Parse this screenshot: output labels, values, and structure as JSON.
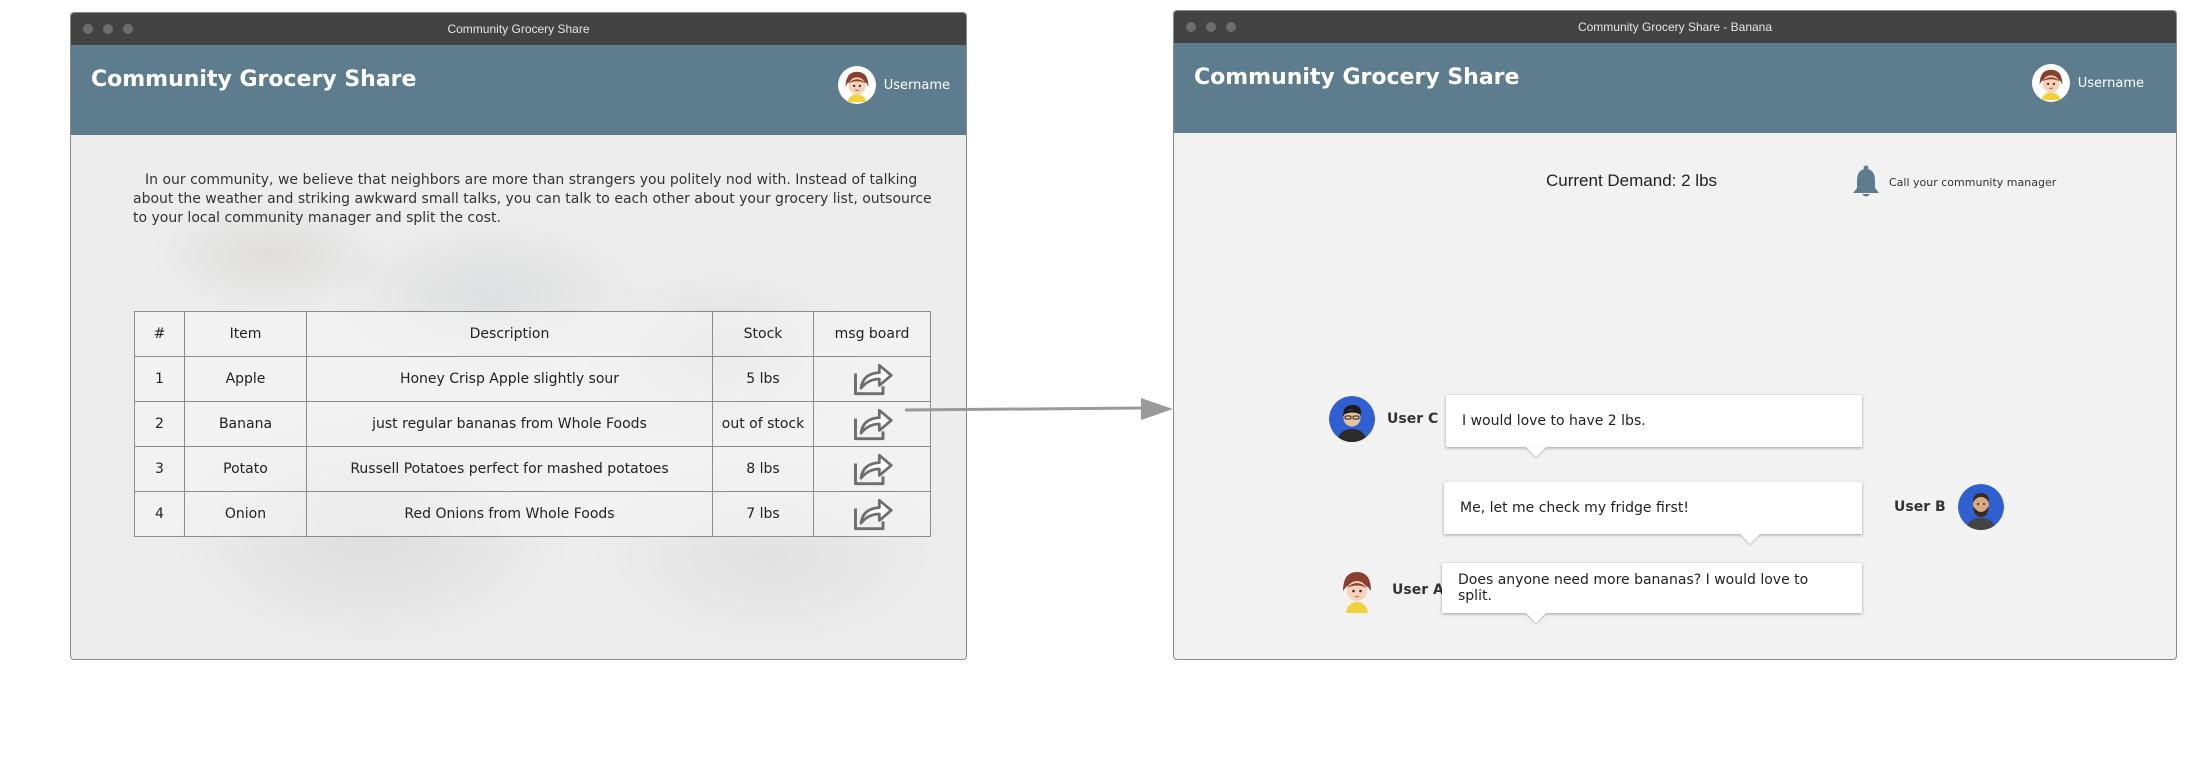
{
  "left_window": {
    "titlebar": "Community Grocery Share",
    "app_title": "Community Grocery Share",
    "username": "Username",
    "intro": "In our community, we believe that neighbors are more than strangers you politely nod with. Instead of talking about the weather and striking awkward small talks, you can talk to each other about your grocery list,  outsource to your local community manager and split the cost.",
    "table": {
      "headers": [
        "#",
        "Item",
        "Description",
        "Stock",
        "msg board"
      ],
      "rows": [
        {
          "num": "1",
          "item": "Apple",
          "description": "Honey Crisp Apple slightly sour",
          "stock": "5 lbs",
          "icon": "share-icon"
        },
        {
          "num": "2",
          "item": "Banana",
          "description": "just regular bananas from Whole Foods",
          "stock": "out of stock",
          "icon": "share-icon"
        },
        {
          "num": "3",
          "item": "Potato",
          "description": "Russell Potatoes perfect for mashed potatoes",
          "stock": "8 lbs",
          "icon": "share-icon"
        },
        {
          "num": "4",
          "item": "Onion",
          "description": "Red Onions from Whole Foods",
          "stock": "7 lbs",
          "icon": "share-icon"
        }
      ]
    }
  },
  "right_window": {
    "titlebar": "Community Grocery Share - Banana",
    "app_title": "Community Grocery Share",
    "username": "Username",
    "current_demand": "Current Demand: 2 lbs",
    "call_manager": "Call your community manager",
    "chat": [
      {
        "user": "User C",
        "message": "I would love to have 2 lbs.",
        "side": "left"
      },
      {
        "user": "User B",
        "message": "Me, let me check my fridge first!",
        "side": "right"
      },
      {
        "user": "User A",
        "message": "Does anyone need more bananas? I would love to split.",
        "side": "left"
      }
    ]
  },
  "colors": {
    "header": "#5d7d8e",
    "titlebar": "#434343",
    "window_bg": "#f2f2f2",
    "arrow": "#9a9a9a"
  }
}
